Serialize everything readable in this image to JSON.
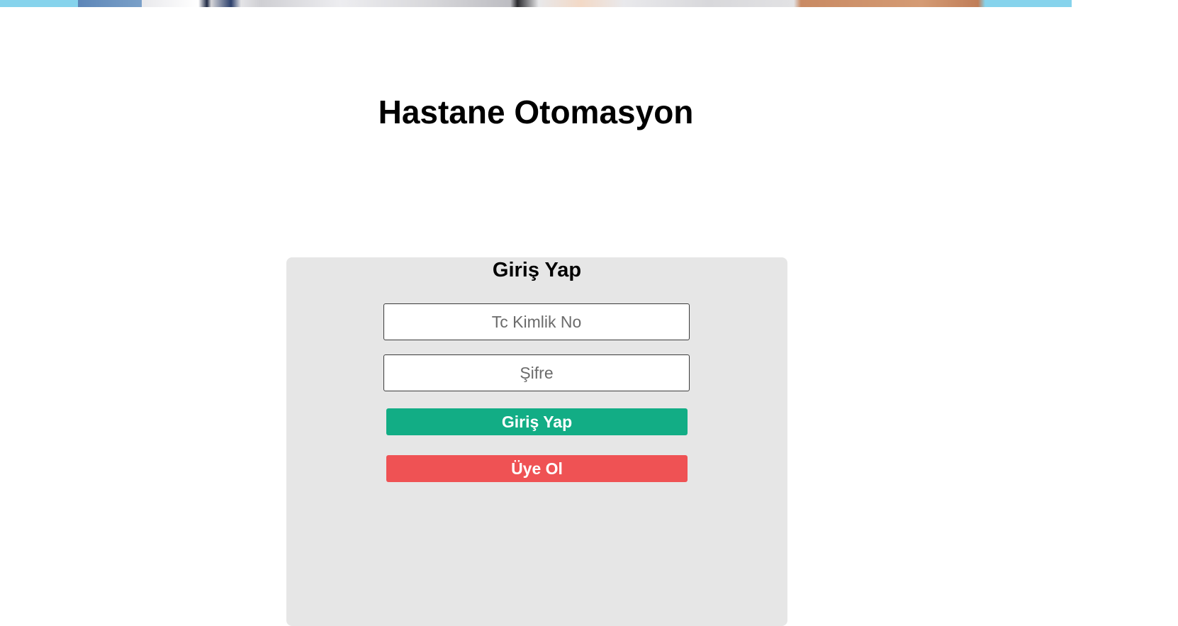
{
  "page": {
    "title": "Hastane Otomasyon"
  },
  "login": {
    "heading": "Giriş Yap",
    "tc_placeholder": "Tc Kimlik No",
    "tc_value": "",
    "password_placeholder": "Şifre",
    "password_value": "",
    "login_button": "Giriş Yap",
    "register_button": "Üye Ol"
  },
  "colors": {
    "card_background": "#e6e6e6",
    "login_button": "#12ad85",
    "register_button": "#ef5254"
  }
}
